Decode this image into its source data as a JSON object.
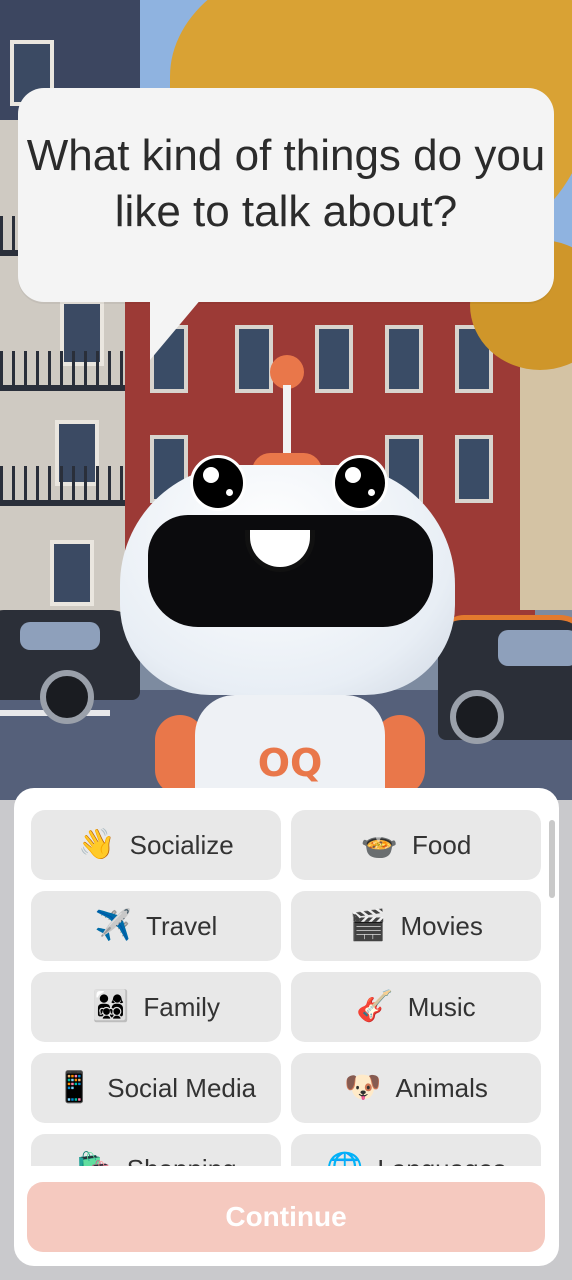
{
  "prompt": {
    "question": "What kind of things do you like to talk about?"
  },
  "mascot": {
    "logo_text": "OQ"
  },
  "topics": [
    {
      "label": "Socialize",
      "emoji": "👋",
      "icon": "waving-hand-icon"
    },
    {
      "label": "Food",
      "emoji": "🍲",
      "icon": "food-pot-icon"
    },
    {
      "label": "Travel",
      "emoji": "✈️",
      "icon": "airplane-icon"
    },
    {
      "label": "Movies",
      "emoji": "🎬",
      "icon": "clapper-board-icon"
    },
    {
      "label": "Family",
      "emoji": "👨‍👩‍👧‍👦",
      "icon": "family-icon"
    },
    {
      "label": "Music",
      "emoji": "🎸",
      "icon": "guitar-icon"
    },
    {
      "label": "Social Media",
      "emoji": "📱",
      "icon": "mobile-phone-icon"
    },
    {
      "label": "Animals",
      "emoji": "🐶",
      "icon": "dog-icon"
    },
    {
      "label": "Shopping",
      "emoji": "🛍️",
      "icon": "shopping-bags-icon"
    },
    {
      "label": "Languages",
      "emoji": "🌐",
      "icon": "globe-icon"
    }
  ],
  "actions": {
    "continue_label": "Continue",
    "continue_enabled": false
  },
  "colors": {
    "accent": "#e9774a",
    "continue_disabled_bg": "#f5c9bf",
    "chip_bg": "#e8e8e8"
  }
}
